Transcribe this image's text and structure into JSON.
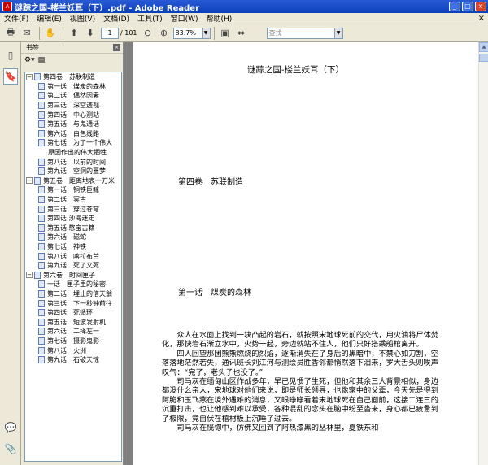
{
  "window": {
    "title": "谜踪之国-楼兰妖耳（下）.pdf - Adobe Reader",
    "minimize": "_",
    "maximize": "□",
    "close": "×"
  },
  "menu": {
    "items": [
      "文件(F)",
      "编辑(E)",
      "视图(V)",
      "文档(D)",
      "工具(T)",
      "窗口(W)",
      "帮助(H)"
    ],
    "close_doc": "×"
  },
  "toolbar": {
    "page_current": "1",
    "page_total": "/ 101",
    "zoom": "83.7%",
    "search_placeholder": "查找"
  },
  "bookmarks": {
    "title": "书签",
    "options_label": "⚙▾",
    "items": [
      {
        "level": 1,
        "expanded": true,
        "text": "第四卷　苏联制造"
      },
      {
        "level": 2,
        "text": "第一话　煤炭的森林"
      },
      {
        "level": 2,
        "text": "第二话　偶然因素"
      },
      {
        "level": 2,
        "text": "第三话　深空透视"
      },
      {
        "level": 2,
        "text": "第四话　中心测站"
      },
      {
        "level": 2,
        "text": "第五话　与鬼通话"
      },
      {
        "level": 2,
        "text": "第六话　白色线路"
      },
      {
        "level": 2,
        "text": "第七话　为了一个伟大"
      },
      {
        "level": 3,
        "text": "原因作出的伟大牺牲"
      },
      {
        "level": 2,
        "text": "第八话　以前的时间"
      },
      {
        "level": 2,
        "text": "第九话　空洞的噩梦"
      },
      {
        "level": 1,
        "expanded": true,
        "text": "第五卷　距离地表一万米"
      },
      {
        "level": 2,
        "text": "第一话　铜铁巨鲸"
      },
      {
        "level": 2,
        "text": "第二话　冥古"
      },
      {
        "level": 2,
        "text": "第三话　穿过苍穹"
      },
      {
        "level": 2,
        "text": "第四话 沙海迷走"
      },
      {
        "level": 2,
        "text": "第五话 憋宝古籍"
      },
      {
        "level": 2,
        "text": "第六话　磁蛇"
      },
      {
        "level": 2,
        "text": "第七话　神铁"
      },
      {
        "level": 2,
        "text": "第八话　喀拉布兰"
      },
      {
        "level": 2,
        "text": "第九话　死了又死"
      },
      {
        "level": 1,
        "expanded": true,
        "text": "第六卷　时间匣子"
      },
      {
        "level": 2,
        "text": "一话　匣子里的秘密"
      },
      {
        "level": 2,
        "text": "第二话　埋止的信天翁"
      },
      {
        "level": 2,
        "text": "第三话　下一秒钟前往"
      },
      {
        "level": 2,
        "text": "第四话　死循环"
      },
      {
        "level": 2,
        "text": "第五话　短波发射机"
      },
      {
        "level": 2,
        "text": "第六话　二择左一"
      },
      {
        "level": 2,
        "text": "第七话　摄影鬼影"
      },
      {
        "level": 2,
        "text": "第八话　火洲"
      },
      {
        "level": 2,
        "text": "第九话　石破天惊"
      }
    ]
  },
  "document": {
    "heading": "谜踪之国-楼兰妖耳（下）",
    "volume_title": "第四卷　苏联制造",
    "chapter_title": "第一话　煤炭的森林",
    "paragraphs": [
      "众人在水面上找到一块凸起的岩石，就按照宋地球死前的交代，用火油将尸体焚化，那快岩石渐立水中，火势一起，旁边就站不住人，他们只好搭乘船棺离开。",
      "四人回望那团熊熊燃烧的烈焰，逐渐消失在了身后的黑暗中，不禁心如刀割，空落落地茫然若失，通讯班长刘江河与测绘员胜香邻都悄然落下泪来，罗大舌头则唉声叹气：“完了，老头子也没了。”",
      "司马灰在缅甸山区作战多年，早已见惯了生死，但他和其余三人背景相似，身边都没什么亲人，宋地球对他们来说，即是师长领导，也像家中的父辈，今天先是得到阿脆和玉飞燕在境外遇难的消息，又眼睁睁看着宋地球死在自己面前，这接二连三的沉重打击，也让他感到难以承受，各种混乱的念头在脑中纷至沓来，身心都已疲惫到了极限，竟自伏在棺材板上沉睡了过去。",
      "司马灰在恍惚中，仿佛又回到了阿热漆黑的丛林里，夏铁东和"
    ]
  }
}
